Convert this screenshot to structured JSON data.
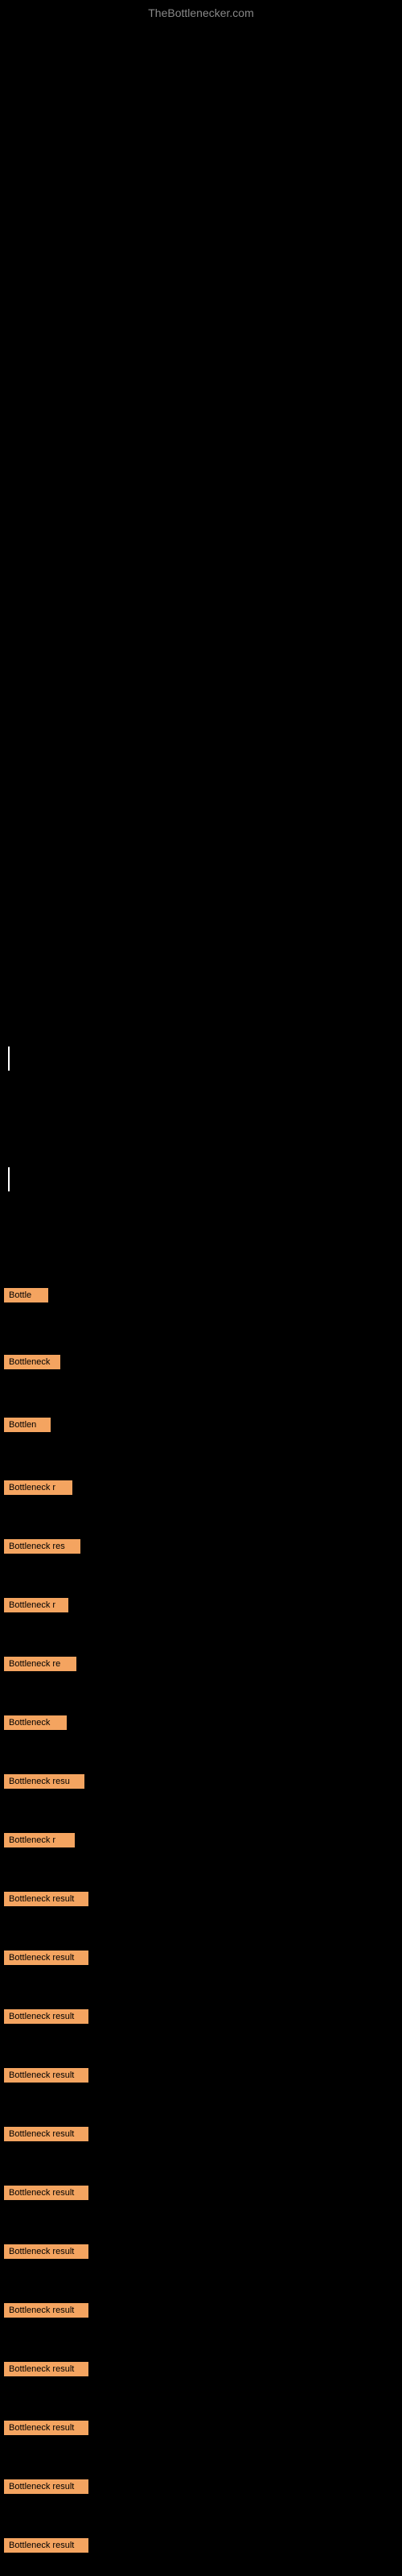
{
  "site": {
    "title": "TheBottlenecker.com"
  },
  "bottleneck_items": [
    {
      "id": 1,
      "label": "Bottle",
      "class": "item-1"
    },
    {
      "id": 2,
      "label": "Bottleneck",
      "class": "item-2"
    },
    {
      "id": 3,
      "label": "Bottlen",
      "class": "item-3"
    },
    {
      "id": 4,
      "label": "Bottleneck r",
      "class": "item-4"
    },
    {
      "id": 5,
      "label": "Bottleneck res",
      "class": "item-5"
    },
    {
      "id": 6,
      "label": "Bottleneck r",
      "class": "item-6"
    },
    {
      "id": 7,
      "label": "Bottleneck re",
      "class": "item-7"
    },
    {
      "id": 8,
      "label": "Bottleneck",
      "class": "item-8"
    },
    {
      "id": 9,
      "label": "Bottleneck resu",
      "class": "item-9"
    },
    {
      "id": 10,
      "label": "Bottleneck r",
      "class": "item-10"
    },
    {
      "id": 11,
      "label": "Bottleneck result",
      "class": "item-11"
    },
    {
      "id": 12,
      "label": "Bottleneck result",
      "class": "item-12"
    },
    {
      "id": 13,
      "label": "Bottleneck result",
      "class": "item-13"
    },
    {
      "id": 14,
      "label": "Bottleneck result",
      "class": "item-14"
    },
    {
      "id": 15,
      "label": "Bottleneck result",
      "class": "item-15"
    },
    {
      "id": 16,
      "label": "Bottleneck result",
      "class": "item-16"
    },
    {
      "id": 17,
      "label": "Bottleneck result",
      "class": "item-17"
    },
    {
      "id": 18,
      "label": "Bottleneck result",
      "class": "item-18"
    },
    {
      "id": 19,
      "label": "Bottleneck result",
      "class": "item-19"
    },
    {
      "id": 20,
      "label": "Bottleneck result",
      "class": "item-20"
    },
    {
      "id": 21,
      "label": "Bottleneck result",
      "class": "item-21"
    },
    {
      "id": 22,
      "label": "Bottleneck result",
      "class": "item-22"
    }
  ]
}
